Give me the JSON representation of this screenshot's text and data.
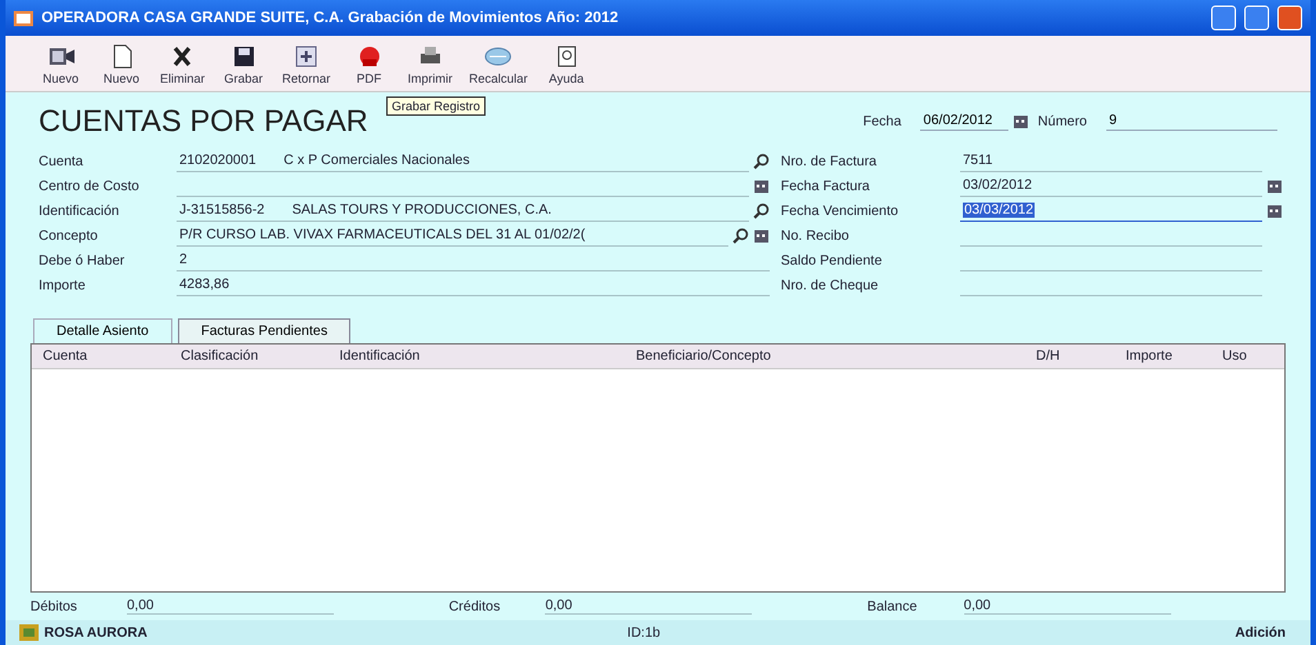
{
  "window": {
    "title": "OPERADORA CASA GRANDE SUITE, C.A. Grabación de Movimientos Año: 2012"
  },
  "toolbar": [
    {
      "label": "Nuevo"
    },
    {
      "label": "Nuevo"
    },
    {
      "label": "Eliminar"
    },
    {
      "label": "Grabar"
    },
    {
      "label": "Retornar"
    },
    {
      "label": "PDF"
    },
    {
      "label": "Imprimir"
    },
    {
      "label": "Recalcular"
    },
    {
      "label": "Ayuda"
    }
  ],
  "tooltip": "Grabar Registro",
  "form": {
    "heading": "CUENTAS POR PAGAR",
    "fecha": {
      "label": "Fecha",
      "value": "06/02/2012"
    },
    "numero": {
      "label": "Número",
      "value": "9"
    },
    "left_fields": [
      {
        "label": "Cuenta",
        "value": "2102020001",
        "detail": "C x P Comerciales Nacionales",
        "lookup": true,
        "picker": false
      },
      {
        "label": "Centro de Costo",
        "lookup": false,
        "picker": true
      },
      {
        "label": "Identificación",
        "value": "J-31515856-2",
        "detail": "SALAS TOURS Y PRODUCCIONES, C.A.",
        "lookup": true,
        "picker": false
      },
      {
        "label": "Concepto",
        "value": "P/R CURSO LAB. VIVAX FARMACEUTICALS DEL 31 AL 01/02/2(",
        "lookup": true,
        "picker": true
      },
      {
        "label": "Debe ó Haber",
        "value": "2",
        "lookup": false,
        "picker": false
      },
      {
        "label": "Importe",
        "value": "4283,86",
        "lookup": false,
        "picker": false
      }
    ],
    "right_fields": [
      {
        "label": "Nro. de Factura",
        "value": "7511",
        "picker": false,
        "selected": false
      },
      {
        "label": "Fecha Factura",
        "value": "03/02/2012",
        "picker": true,
        "selected": false
      },
      {
        "label": "Fecha Vencimiento",
        "value": "03/03/2012",
        "picker": true,
        "selected": true
      },
      {
        "label": "No. Recibo",
        "picker": false,
        "selected": false
      },
      {
        "label": "Saldo Pendiente",
        "picker": false,
        "selected": false
      },
      {
        "label": "Nro. de Cheque",
        "picker": false,
        "selected": false
      }
    ]
  },
  "tabs": [
    {
      "label": "Detalle Asiento",
      "selected": true
    },
    {
      "label": "Facturas Pendientes",
      "selected": false
    }
  ],
  "table": {
    "columns": [
      "Cuenta",
      "Clasificación",
      "Identificación",
      "Beneficiario/Concepto",
      "D/H",
      "Importe",
      "Uso"
    ]
  },
  "totals": [
    {
      "label": "Débitos",
      "value": "0,00"
    },
    {
      "label": "Créditos",
      "value": "0,00"
    },
    {
      "label": "Balance",
      "value": "0,00"
    }
  ],
  "status_bar": {
    "user": "ROSA AURORA",
    "id": "ID:1b",
    "mode": "Adición"
  }
}
